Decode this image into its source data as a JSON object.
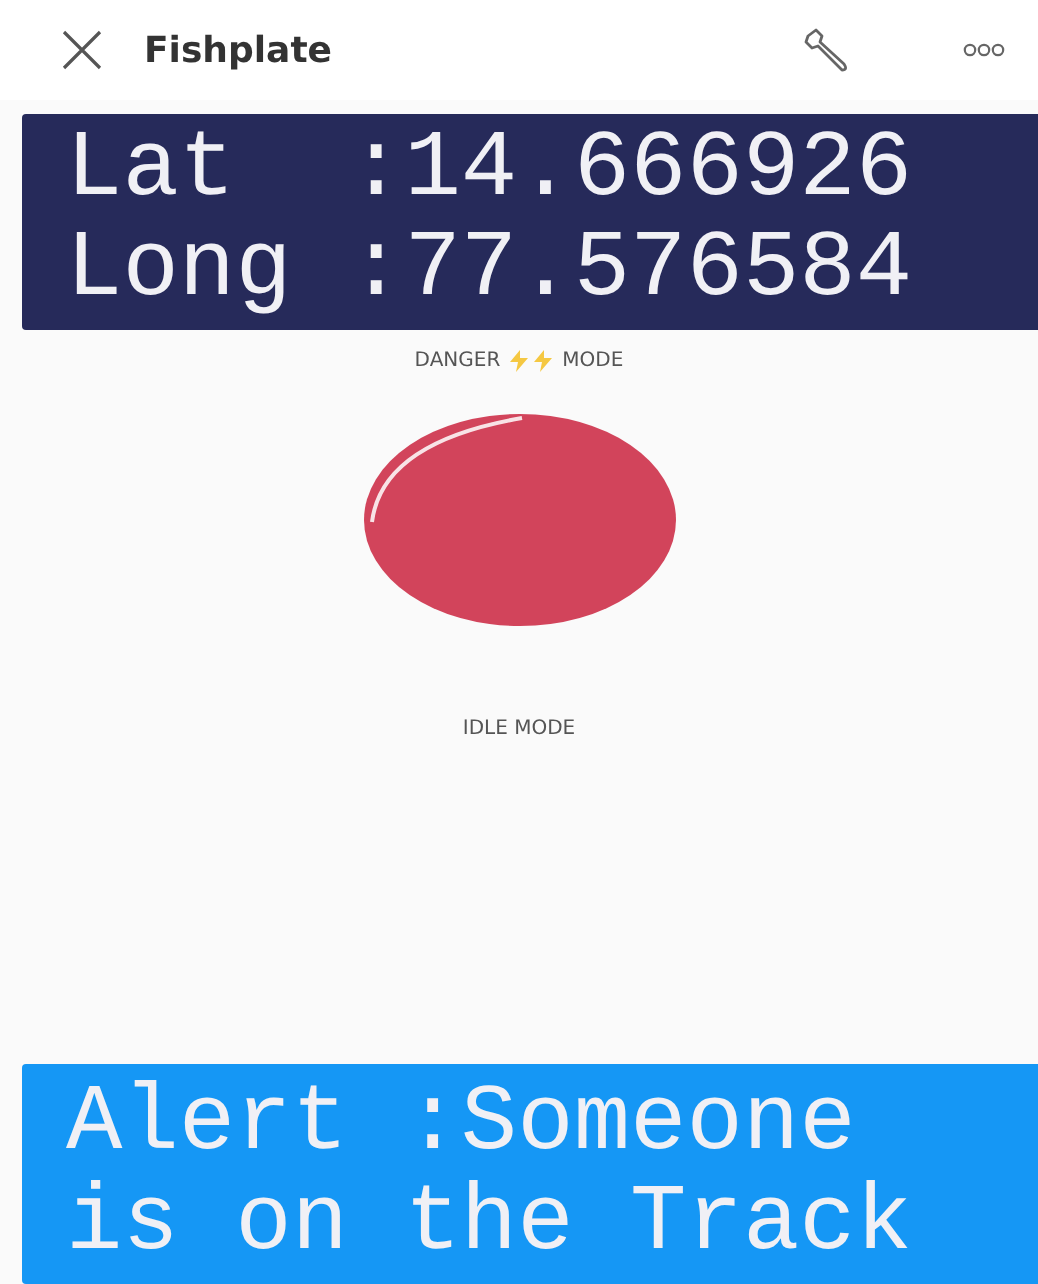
{
  "header": {
    "title": "Fishplate"
  },
  "location_display": {
    "lines": [
      "Lat  :14.666926",
      "Long :77.576584"
    ]
  },
  "danger_label": {
    "before": "DANGER",
    "after": "MODE"
  },
  "idle_label": "IDLE MODE",
  "alert_display": {
    "lines": [
      "Alert :Someone",
      "is on the Track"
    ]
  }
}
